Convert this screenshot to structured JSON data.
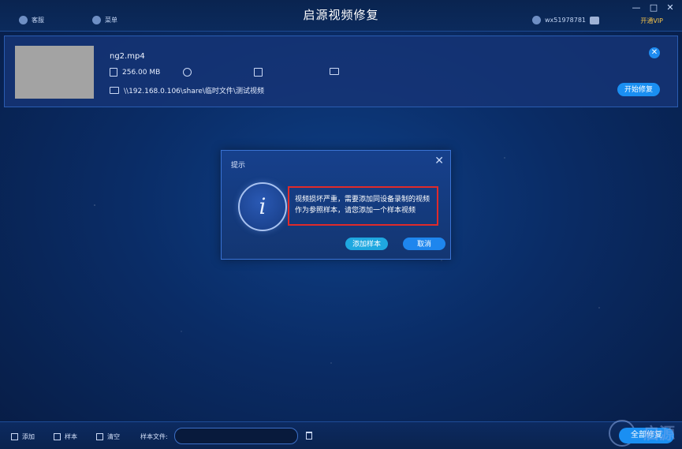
{
  "app": {
    "title": "启源视频修复"
  },
  "titlebar": {
    "service_label": "客服",
    "menu_label": "菜单",
    "username": "wx51978781",
    "vip_label": "开通VIP",
    "minimize": "—",
    "maximize": "□",
    "close": "✕"
  },
  "file": {
    "name": "ng2.mp4",
    "size": "256.00 MB",
    "path": "\\\\192.168.0.106\\share\\临时文件\\测试视频",
    "repair_label": "开始修复",
    "remove": "✕"
  },
  "dialog": {
    "title": "提示",
    "close": "✕",
    "icon_glyph": "i",
    "message": "视频损坏严重，需要添加同设备录制的视频作为参照样本，请您添加一个样本视频",
    "add_sample_label": "添加样本",
    "cancel_label": "取消"
  },
  "bottombar": {
    "add_label": "添加",
    "sample_label": "样本",
    "clear_label": "清空",
    "sample_file_label": "样本文件:",
    "sample_file_value": "",
    "repair_all_label": "全部修复",
    "watermark": "启源"
  }
}
